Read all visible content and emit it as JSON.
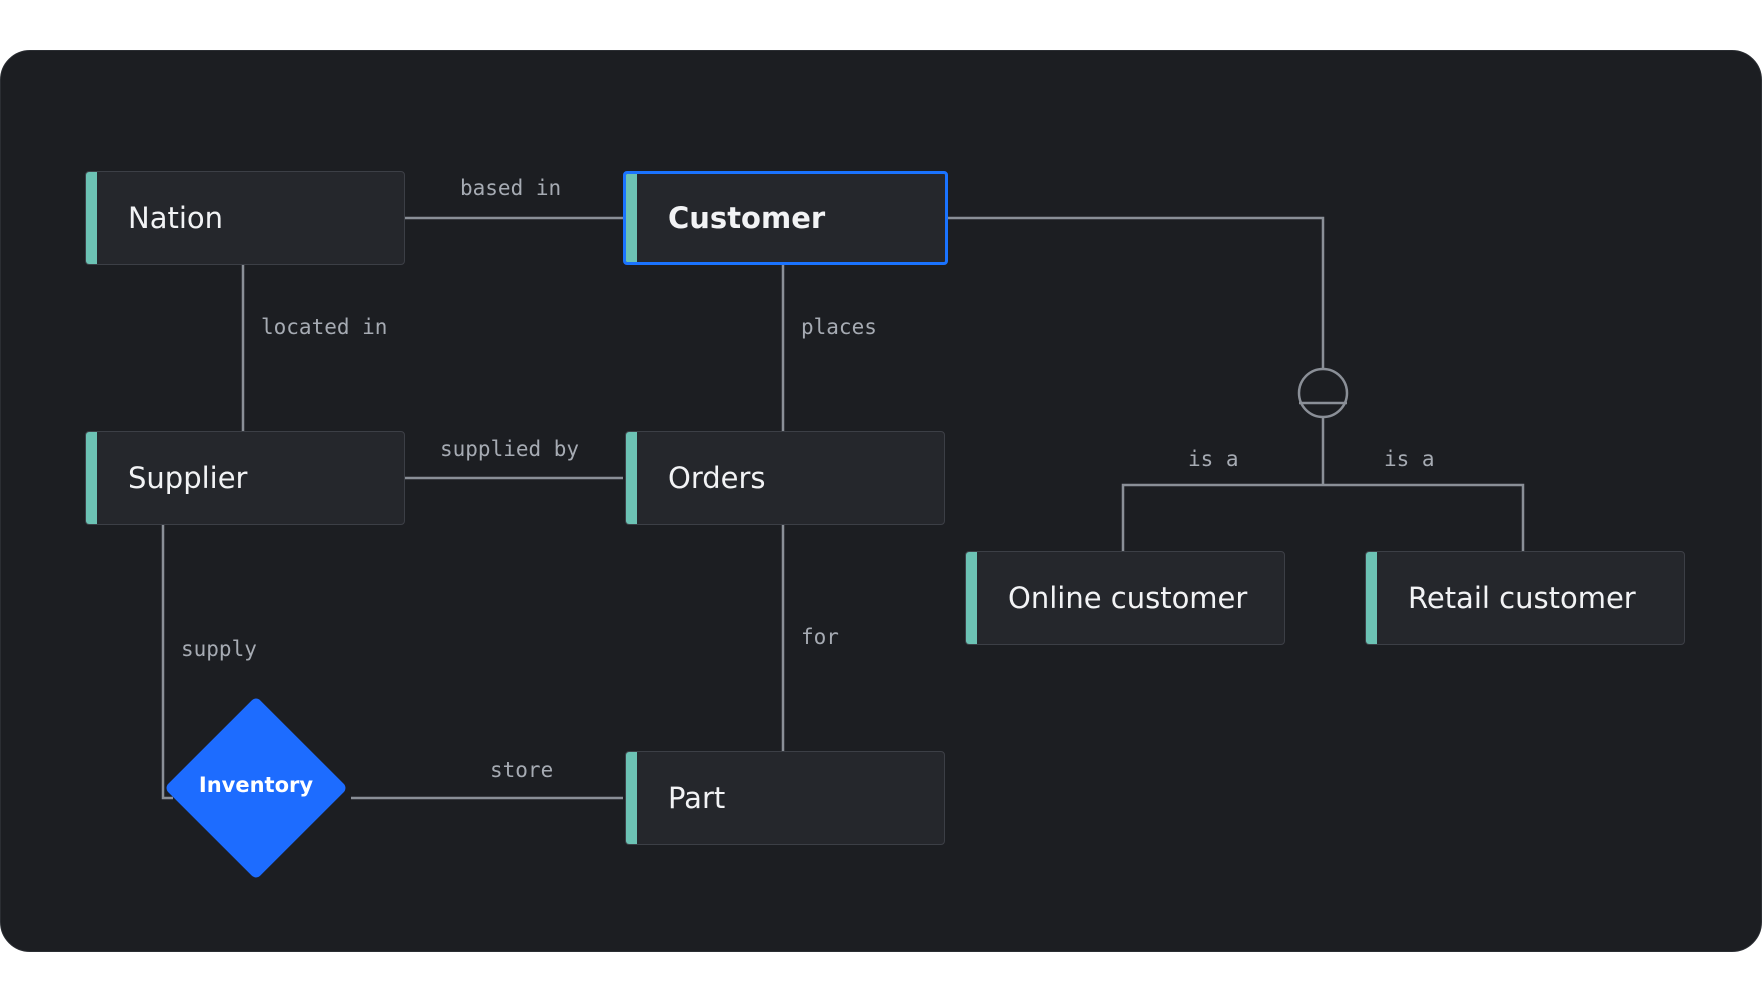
{
  "entities": {
    "nation": "Nation",
    "customer": "Customer",
    "supplier": "Supplier",
    "orders": "Orders",
    "part": "Part",
    "online_customer": "Online customer",
    "retail_customer": "Retail customer"
  },
  "relationship": {
    "inventory": "Inventory"
  },
  "edge_labels": {
    "based_in": "based in",
    "located_in": "located in",
    "places": "places",
    "supplied_by": "supplied by",
    "supply": "supply",
    "for": "for",
    "store": "store",
    "is_a_left": "is a",
    "is_a_right": "is a"
  },
  "colors": {
    "background": "#1c1e22",
    "entity_fill": "#25272c",
    "accent": "#6cc2b4",
    "selection": "#1a73ff",
    "relationship_fill": "#1d6cff",
    "connector": "#8a8f97"
  }
}
